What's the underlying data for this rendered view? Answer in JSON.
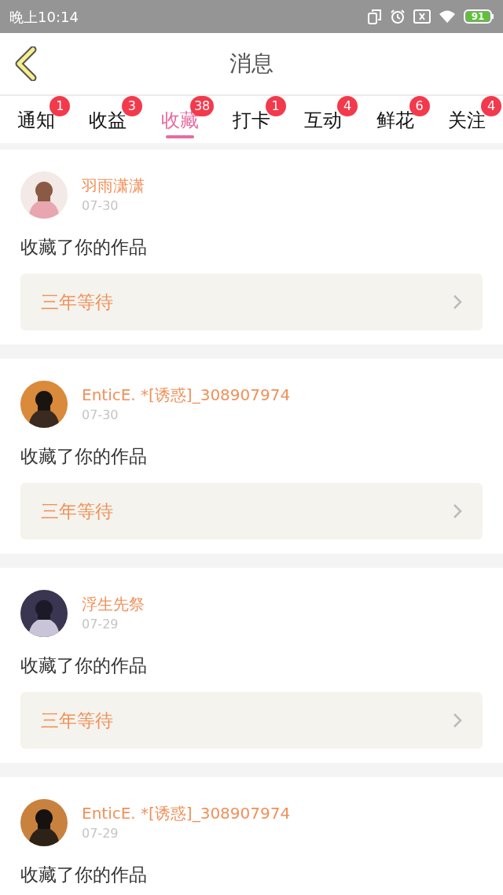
{
  "status_bar": {
    "time": "晚上10:14",
    "battery": "91"
  },
  "header": {
    "title": "消息"
  },
  "tabs": [
    {
      "label": "通知",
      "badge": "1",
      "selected": false
    },
    {
      "label": "收益",
      "badge": "3",
      "selected": false
    },
    {
      "label": "收藏",
      "badge": "38",
      "selected": true
    },
    {
      "label": "打卡",
      "badge": "1",
      "selected": false
    },
    {
      "label": "互动",
      "badge": "4",
      "selected": false
    },
    {
      "label": "鲜花",
      "badge": "6",
      "selected": false
    },
    {
      "label": "关注",
      "badge": "4",
      "selected": false
    }
  ],
  "messages": [
    {
      "user": "羽雨潇潇",
      "date": "07-30",
      "text": "收藏了你的作品",
      "work": "三年等待"
    },
    {
      "user": "EnticE. *[诱惑]_308907974",
      "date": "07-30",
      "text": "收藏了你的作品",
      "work": "三年等待"
    },
    {
      "user": "浮生先祭",
      "date": "07-29",
      "text": "收藏了你的作品",
      "work": "三年等待"
    },
    {
      "user": "EnticE. *[诱惑]_308907974",
      "date": "07-29",
      "text": "收藏了你的作品"
    }
  ]
}
